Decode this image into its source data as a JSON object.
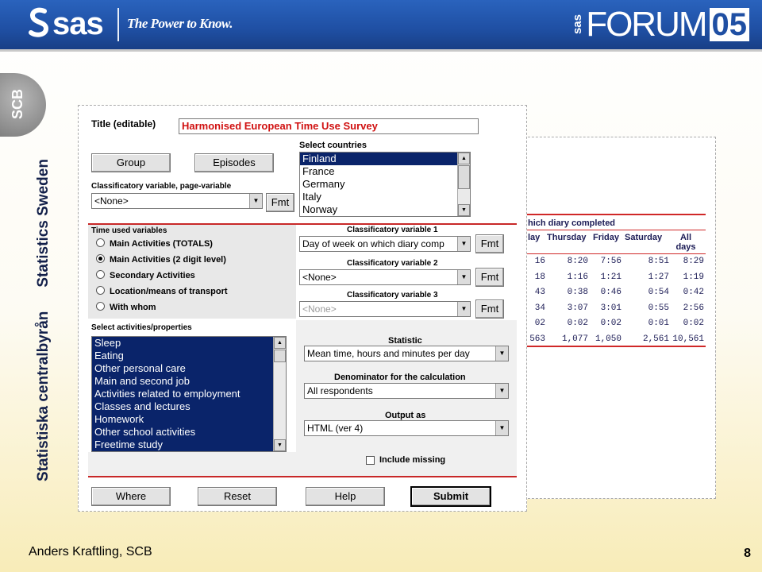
{
  "header": {
    "brand": "sas",
    "tagline": "The Power to Know.",
    "forum_prefix": "sas",
    "forum_label": "FORUM",
    "forum_year": "05"
  },
  "sidebar": {
    "logo_text": "SCB",
    "org_swedish": "Statistiska centralbyrån",
    "org_english": "Statistics Sweden"
  },
  "form": {
    "title_label": "Title (editable)",
    "title_value": "Harmonised European Time Use Survey",
    "group_button": "Group",
    "episodes_button": "Episodes",
    "select_countries_label": "Select countries",
    "countries": [
      "Finland",
      "France",
      "Germany",
      "Italy",
      "Norway"
    ],
    "countries_selected": "Finland",
    "classificatory_page_label": "Classificatory variable, page-variable",
    "page_variable_value": "<None>",
    "fmt_label": "Fmt",
    "time_used_label": "Time used variables",
    "time_used_options": [
      {
        "label": "Main Activities (TOTALS)",
        "checked": false
      },
      {
        "label": "Main Activities (2 digit level)",
        "checked": true
      },
      {
        "label": "Secondary Activities",
        "checked": false
      },
      {
        "label": "Location/means of transport",
        "checked": false
      },
      {
        "label": "With whom",
        "checked": false
      }
    ],
    "class_var1_label": "Classificatory variable 1",
    "class_var1_value": "Day of week on which diary comp",
    "class_var2_label": "Classificatory variable 2",
    "class_var2_value": "<None>",
    "class_var3_label": "Classificatory variable 3",
    "class_var3_value": "<None>",
    "activities_label": "Select activities/properties",
    "activities": [
      "Sleep",
      "Eating",
      "Other personal care",
      "Main and second job",
      "Activities related to employment",
      "Classes and lectures",
      "Homework",
      "Other school activities",
      "Freetime study"
    ],
    "statistic_label": "Statistic",
    "statistic_value": "Mean time, hours and minutes per day",
    "denominator_label": "Denominator for the calculation",
    "denominator_value": "All respondents",
    "output_label": "Output as",
    "output_value": "HTML (ver 4)",
    "include_missing_label": "Include missing",
    "where_button": "Where",
    "reset_button": "Reset",
    "help_button": "Help",
    "submit_button": "Submit"
  },
  "result_table": {
    "heading": "hich diary completed",
    "columns": [
      "lay",
      "Thursday",
      "Friday",
      "Saturday",
      "All days"
    ],
    "rows": [
      [
        "16",
        "8:20",
        "7:56",
        "8:51",
        "8:29"
      ],
      [
        "18",
        "1:16",
        "1:21",
        "1:27",
        "1:19"
      ],
      [
        "43",
        "0:38",
        "0:46",
        "0:54",
        "0:42"
      ],
      [
        "34",
        "3:07",
        "3:01",
        "0:55",
        "2:56"
      ],
      [
        "02",
        "0:02",
        "0:02",
        "0:01",
        "0:02"
      ],
      [
        "563",
        "1,077",
        "1,050",
        "2,561",
        "10,561"
      ]
    ]
  },
  "footer": {
    "author": "Anders Kraftling, SCB",
    "page_number": "8"
  }
}
